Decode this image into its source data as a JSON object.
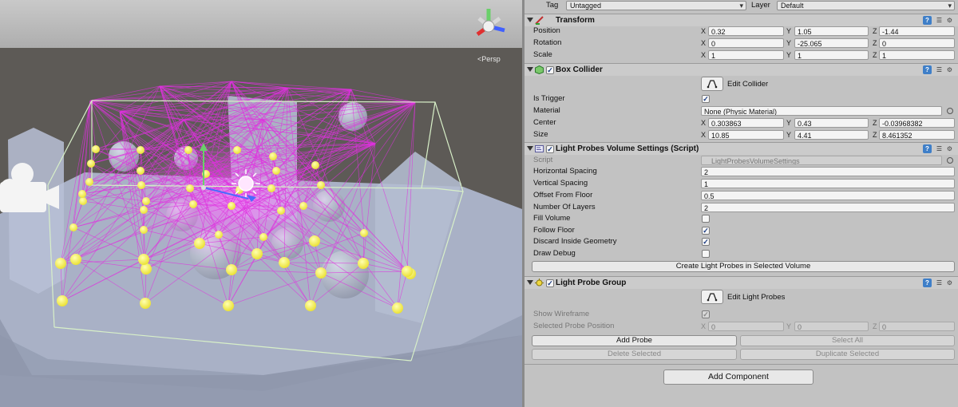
{
  "scene": {
    "view_label": "Persp"
  },
  "top": {
    "tag_label": "Tag",
    "tag_value": "Untagged",
    "layer_label": "Layer",
    "layer_value": "Default"
  },
  "transform": {
    "title": "Transform",
    "position_label": "Position",
    "position": {
      "x": "0.32",
      "y": "1.05",
      "z": "-1.44"
    },
    "rotation_label": "Rotation",
    "rotation": {
      "x": "0",
      "y": "-25.065",
      "z": "0"
    },
    "scale_label": "Scale",
    "scale": {
      "x": "1",
      "y": "1",
      "z": "1"
    }
  },
  "axes": {
    "x": "X",
    "y": "Y",
    "z": "Z"
  },
  "box_collider": {
    "title": "Box Collider",
    "edit_label": "Edit Collider",
    "is_trigger_label": "Is Trigger",
    "is_trigger": true,
    "material_label": "Material",
    "material_value": "None (Physic Material)",
    "center_label": "Center",
    "center": {
      "x": "0.303863",
      "y": "0.43",
      "z": "-0.03968382"
    },
    "size_label": "Size",
    "size": {
      "x": "10.85",
      "y": "4.41",
      "z": "8.461352"
    }
  },
  "lpv_settings": {
    "title": "Light Probes Volume Settings (Script)",
    "script_label": "Script",
    "script_value": "LightProbesVolumeSettings",
    "horizontal_spacing_label": "Horizontal Spacing",
    "horizontal_spacing": "2",
    "vertical_spacing_label": "Vertical Spacing",
    "vertical_spacing": "1",
    "offset_label": "Offset From Floor",
    "offset": "0.5",
    "layers_label": "Number Of Layers",
    "layers": "2",
    "fill_volume_label": "Fill Volume",
    "fill_volume": false,
    "follow_floor_label": "Follow Floor",
    "follow_floor": true,
    "discard_label": "Discard Inside Geometry",
    "discard": true,
    "draw_debug_label": "Draw Debug",
    "draw_debug": false,
    "create_button": "Create Light Probes in Selected Volume"
  },
  "probe_group": {
    "title": "Light Probe Group",
    "edit_label": "Edit Light Probes",
    "show_wireframe_label": "Show Wireframe",
    "show_wireframe": true,
    "selected_pos_label": "Selected Probe Position",
    "selected_pos": {
      "x": "0",
      "y": "0",
      "z": "0"
    },
    "add_probe": "Add Probe",
    "select_all": "Select All",
    "delete_selected": "Delete Selected",
    "duplicate_selected": "Duplicate Selected"
  },
  "add_component": "Add Component",
  "colors": {
    "probe": "#f5f04a",
    "wire": "#e030e0",
    "help": "#3f7fc8"
  }
}
